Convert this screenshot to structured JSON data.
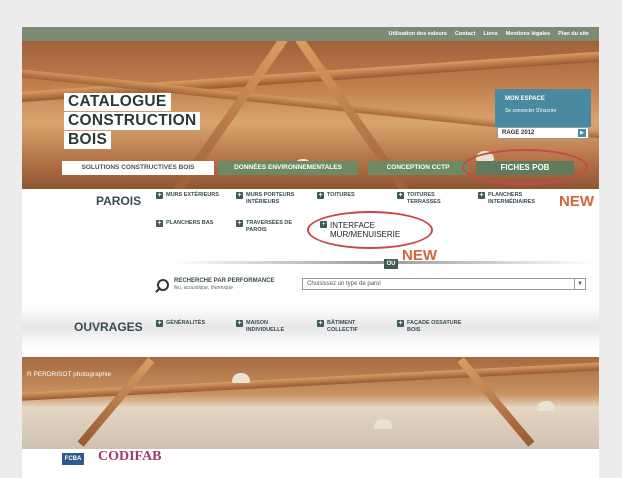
{
  "topnav": [
    "Utilisation des valeurs",
    "Contact",
    "Liens",
    "Mentions légales",
    "Plan du site"
  ],
  "logo": [
    "CATALOGUE",
    "CONSTRUCTION",
    "BOIS"
  ],
  "espace": {
    "title": "MON ESPACE",
    "links": "Se connecter  S'inscrire"
  },
  "rage": "RAGE 2012",
  "tabs": [
    "SOLUTIONS CONSTRUCTIVES BOIS",
    "DONNÉES ENVIRONNEMENTALES",
    "CONCEPTION CCTP",
    "FICHES POB"
  ],
  "parois": {
    "heading": "PAROIS",
    "items": [
      "MURS EXTÉRIEURS",
      "MURS PORTEURS INTÉRIEURS",
      "TOITURES",
      "TOITURES TERRASSES",
      "PLANCHERS INTERMÉDIAIRES",
      "PLANCHERS BAS",
      "TRAVERSÉES DE PAROIS",
      "INTERFACE MUR/MENUISERIE"
    ]
  },
  "new_label": "NEW",
  "ou": "OU",
  "search": {
    "label": "RECHERCHE PAR PERFORMANCE",
    "sub": "feu, acoustique, thermique",
    "placeholder": "Choisissez un type de paroi"
  },
  "ouvrages": {
    "heading": "OUVRAGES",
    "items": [
      "GÉNÉRALITÉS",
      "MAISON INDIVIDUELLE",
      "BÂTIMENT COLLECTIF",
      "FAÇADE OSSATURE BOIS"
    ]
  },
  "photo_credit": "R PERDRISOT photographie",
  "partners": [
    "FCBA",
    "CODIFAB"
  ],
  "colors": {
    "accent_red": "#c74848",
    "new_orange": "#d2653a",
    "teal": "#3d5a55"
  }
}
